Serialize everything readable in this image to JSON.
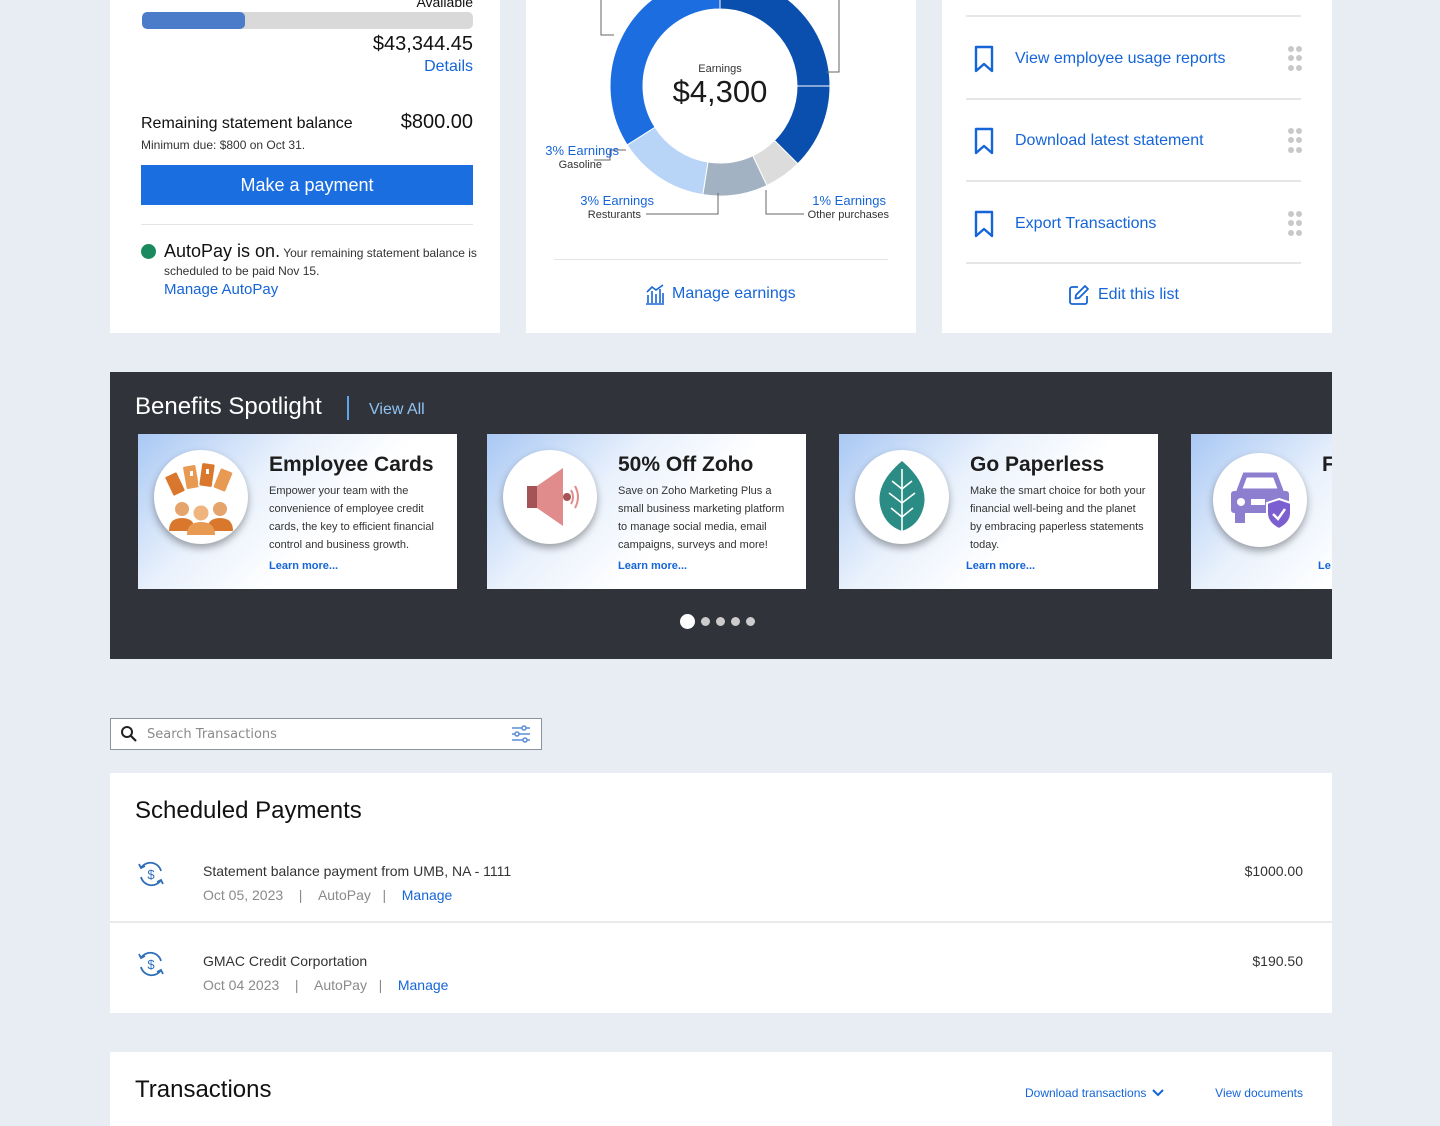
{
  "balance": {
    "available_label": "Available",
    "available_fraction": 0.31,
    "available_amount": "$43,344.45",
    "details_link": "Details",
    "remaining_label": "Remaining statement balance",
    "remaining_amount": "$800.00",
    "minimum_due": "Minimum due: $800 on Oct 31.",
    "pay_button": "Make a payment",
    "autopay_heading": "AutoPay is on.",
    "autopay_message": "Your remaining statement balance is scheduled to be paid Nov 15.",
    "manage_autopay": "Manage AutoPay"
  },
  "earnings": {
    "center_label": "Earnings",
    "center_value": "$4,300",
    "manage_link": "Manage earnings",
    "callouts": [
      {
        "title": "3% Earnings",
        "sub": "Gasoline"
      },
      {
        "title": "3% Earnings",
        "sub": "Resturants"
      },
      {
        "title": "1% Earnings",
        "sub": "Other purchases"
      }
    ]
  },
  "chart_data": {
    "type": "pie",
    "center_label": "Earnings",
    "center_value": "$4,300",
    "slices": [
      {
        "label": "",
        "fraction": 0.25,
        "color": "#0b4fae"
      },
      {
        "label": "",
        "fraction": 0.125,
        "color": "#0b4fae"
      },
      {
        "label": "1% Earnings Other purchases",
        "fraction": 0.055,
        "color": "#dcdcdc"
      },
      {
        "label": "3% Earnings Resturants",
        "fraction": 0.095,
        "color": "#a2b2c2"
      },
      {
        "label": "3% Earnings Gasoline",
        "fraction": 0.135,
        "color": "#b8d5f8"
      },
      {
        "label": "",
        "fraction": 0.34,
        "color": "#1c6ee0"
      }
    ]
  },
  "quick_links": {
    "items": [
      {
        "label": "View employee usage reports"
      },
      {
        "label": "Download latest statement"
      },
      {
        "label": "Export Transactions"
      }
    ],
    "edit_link": "Edit this list"
  },
  "benefits": {
    "title": "Benefits Spotlight",
    "view_all": "View All",
    "cards": [
      {
        "title": "Employee Cards",
        "desc": "Empower your team with the convenience of employee credit cards, the key to efficient financial control and business growth.",
        "learn": "Learn more...",
        "icon": "employee-cards-icon"
      },
      {
        "title": "50% Off Zoho",
        "desc": "Save on Zoho Marketing Plus a small business marketing platform to manage social media, email campaigns, surveys and more!",
        "learn": "Learn more...",
        "icon": "megaphone-icon"
      },
      {
        "title": "Go Paperless",
        "desc": "Make the smart choice for both your financial well-being and the planet by embracing paperless statements today.",
        "learn": "Learn more...",
        "icon": "leaf-icon"
      },
      {
        "title": "F",
        "desc": "M yo pl st",
        "learn": "Le",
        "icon": "car-shield-icon"
      }
    ],
    "carousel": {
      "count": 5,
      "active": 0
    }
  },
  "search": {
    "placeholder": "Search Transactions"
  },
  "scheduled": {
    "title": "Scheduled Payments",
    "payments": [
      {
        "name": "Statement balance payment from UMB, NA - 1111",
        "date": "Oct 05, 2023",
        "type": "AutoPay",
        "manage": "Manage",
        "amount": "$1000.00"
      },
      {
        "name": "GMAC Credit Corportation",
        "date": "Oct 04 2023",
        "type": "AutoPay",
        "manage": "Manage",
        "amount": "$190.50"
      }
    ]
  },
  "transactions": {
    "title": "Transactions",
    "download": "Download transactions",
    "view_documents": "View documents"
  }
}
